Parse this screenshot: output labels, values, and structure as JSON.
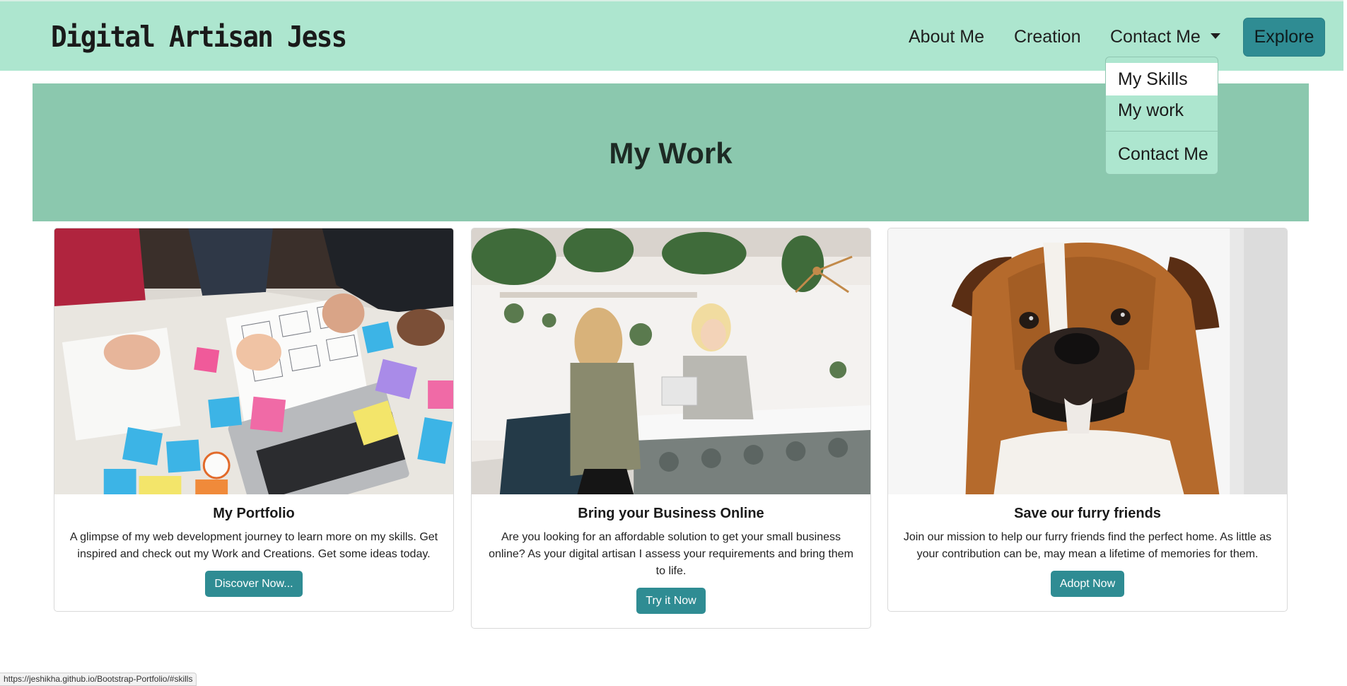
{
  "navbar": {
    "brand": "Digital Artisan Jess",
    "links": [
      "About Me",
      "Creation",
      "Contact Me"
    ],
    "explore_label": "Explore"
  },
  "dropdown": {
    "items": [
      "My Skills",
      "My work",
      "Contact Me"
    ],
    "active_index": 0
  },
  "hero": {
    "title": "My Work"
  },
  "cards": [
    {
      "title": "My Portfolio",
      "text": "A glimpse of my web development journey to learn more on my skills. Get inspired and check out my Work and Creations. Get some ideas today.",
      "button": "Discover Now..."
    },
    {
      "title": "Bring your Business Online",
      "text": "Are you looking for an affordable solution to get your small business online? As your digital artisan I assess your requirements and bring them to life.",
      "button": "Try it Now"
    },
    {
      "title": "Save our furry friends",
      "text": "Join our mission to help our furry friends find the perfect home. As little as your contribution can be, may mean a lifetime of memories for them.",
      "button": "Adopt Now"
    }
  ],
  "status_bar": {
    "url": "https://jeshikha.github.io/Bootstrap-Portfolio/#skills"
  },
  "colors": {
    "navbar_bg": "#ade6cf",
    "hero_bg": "#8bc8ae",
    "button_bg": "#2f8c93"
  }
}
